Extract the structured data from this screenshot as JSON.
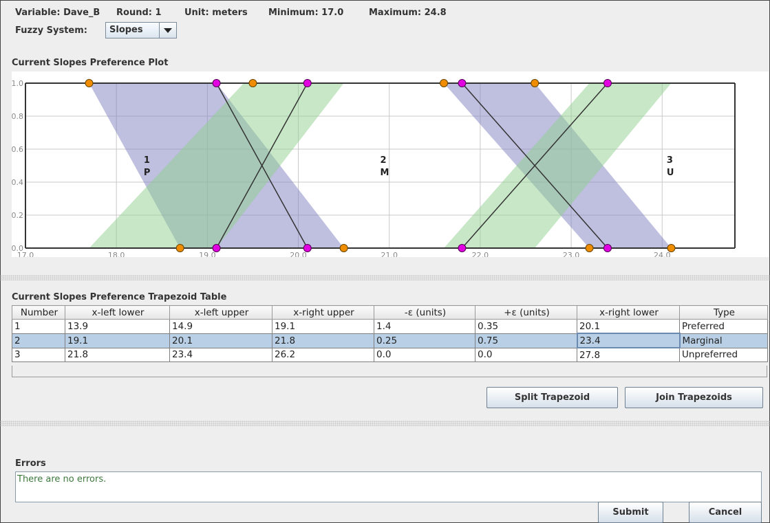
{
  "header": {
    "variable": "Variable: Dave_B",
    "round": "Round: 1",
    "unit": "Unit: meters",
    "minimum": "Minimum: 17.0",
    "maximum": "Maximum: 24.8"
  },
  "fuzzy_system": {
    "label": "Fuzzy System:",
    "selected": "Slopes"
  },
  "plot": {
    "title": "Current Slopes Preference Plot"
  },
  "chart_data": {
    "type": "area",
    "xlim": [
      17.0,
      24.8
    ],
    "ylim": [
      0.0,
      1.0
    ],
    "x_ticks": [
      "17.0",
      "18.0",
      "19.0",
      "20.0",
      "21.0",
      "22.0",
      "23.0",
      "24.0"
    ],
    "y_ticks": [
      "0.0",
      "0.2",
      "0.4",
      "0.6",
      "0.8",
      "1.0"
    ],
    "grid": true,
    "bands": [
      {
        "color": "#8080c0",
        "points": [
          [
            17.7,
            1.0
          ],
          [
            19.1,
            1.0
          ],
          [
            20.5,
            0.0
          ],
          [
            18.7,
            0.0
          ]
        ]
      },
      {
        "color": "#8fcf8f",
        "points": [
          [
            17.7,
            0.0
          ],
          [
            19.1,
            0.0
          ],
          [
            20.5,
            1.0
          ],
          [
            19.4,
            1.0
          ]
        ]
      },
      {
        "color": "#8080c0",
        "points": [
          [
            21.6,
            1.0
          ],
          [
            22.6,
            1.0
          ],
          [
            24.1,
            0.0
          ],
          [
            23.2,
            0.0
          ]
        ]
      },
      {
        "color": "#8fcf8f",
        "points": [
          [
            21.6,
            0.0
          ],
          [
            22.6,
            0.0
          ],
          [
            24.1,
            1.0
          ],
          [
            23.2,
            1.0
          ]
        ]
      }
    ],
    "lines": [
      [
        [
          19.1,
          1.0
        ],
        [
          20.1,
          0.0
        ]
      ],
      [
        [
          19.1,
          0.0
        ],
        [
          20.1,
          1.0
        ]
      ],
      [
        [
          21.8,
          1.0
        ],
        [
          23.4,
          0.0
        ]
      ],
      [
        [
          21.8,
          0.0
        ],
        [
          23.4,
          1.0
        ]
      ]
    ],
    "orange_points": [
      [
        17.7,
        1.0
      ],
      [
        19.5,
        1.0
      ],
      [
        21.6,
        1.0
      ],
      [
        22.6,
        1.0
      ],
      [
        18.7,
        0.0
      ],
      [
        20.5,
        0.0
      ],
      [
        23.2,
        0.0
      ],
      [
        24.1,
        0.0
      ]
    ],
    "magenta_points": [
      [
        19.1,
        1.0
      ],
      [
        20.1,
        1.0
      ],
      [
        21.8,
        1.0
      ],
      [
        23.4,
        1.0
      ],
      [
        19.1,
        0.0
      ],
      [
        20.1,
        0.0
      ],
      [
        21.8,
        0.0
      ],
      [
        23.4,
        0.0
      ]
    ],
    "labels": [
      {
        "x": 18.3,
        "y": 0.5,
        "num": "1",
        "letter": "P"
      },
      {
        "x": 20.9,
        "y": 0.5,
        "num": "2",
        "letter": "M"
      },
      {
        "x": 24.05,
        "y": 0.5,
        "num": "3",
        "letter": "U"
      }
    ]
  },
  "table": {
    "title": "Current Slopes Preference Trapezoid Table",
    "columns": [
      "Number",
      "x-left lower",
      "x-left upper",
      "x-right upper",
      "-ε (units)",
      "+ε (units)",
      "x-right lower",
      "Type"
    ],
    "rows": [
      [
        "1",
        "13.9",
        "14.9",
        "19.1",
        "1.4",
        "0.35",
        "20.1",
        "Preferred"
      ],
      [
        "2",
        "19.1",
        "20.1",
        "21.8",
        "0.25",
        "0.75",
        "23.4",
        "Marginal"
      ],
      [
        "3",
        "21.8",
        "23.4",
        "26.2",
        "0.0",
        "0.0",
        "27.8",
        "Unpreferred"
      ]
    ],
    "selected_row": 1
  },
  "buttons": {
    "split": "Split Trapezoid",
    "join": "Join Trapezoids",
    "submit": "Submit",
    "cancel": "Cancel"
  },
  "errors": {
    "title": "Errors",
    "message": "There are no errors."
  }
}
